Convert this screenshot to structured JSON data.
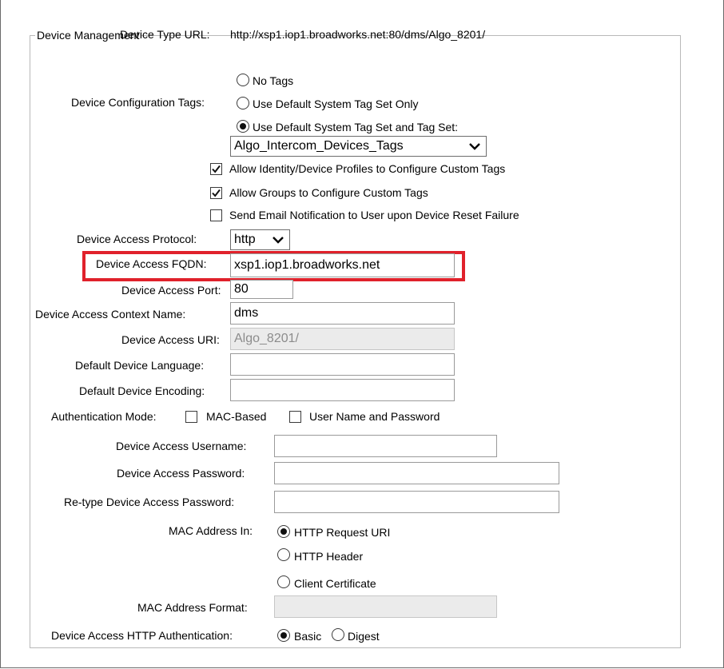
{
  "section": {
    "legend": "Device Management"
  },
  "device_type_url": {
    "label": "Device Type URL:",
    "value": "http://xsp1.iop1.broadworks.net:80/dms/Algo_8201/"
  },
  "config_tags": {
    "label": "Device Configuration Tags:",
    "opt_no_tags": "No Tags",
    "opt_default_only": "Use Default System Tag Set Only",
    "opt_default_and_set": "Use Default System Tag Set and Tag Set:",
    "selected": "opt_default_and_set",
    "tag_set_value": "Algo_Intercom_Devices_Tags"
  },
  "checkboxes": {
    "allow_identity": {
      "label": "Allow Identity/Device Profiles to Configure Custom Tags",
      "checked": true
    },
    "allow_groups": {
      "label": "Allow Groups to Configure Custom Tags",
      "checked": true
    },
    "send_email": {
      "label": "Send Email Notification to User upon Device Reset Failure",
      "checked": false
    }
  },
  "access_protocol": {
    "label": "Device Access Protocol:",
    "value": "http"
  },
  "access_fqdn": {
    "label": "Device Access FQDN:",
    "value": "xsp1.iop1.broadworks.net"
  },
  "access_port": {
    "label": "Device Access Port:",
    "value": "80"
  },
  "context_name": {
    "label": "Device Access Context Name:",
    "value": "dms"
  },
  "access_uri": {
    "label": "Device Access URI:",
    "value": "Algo_8201/"
  },
  "default_language": {
    "label": "Default Device Language:",
    "value": ""
  },
  "default_encoding": {
    "label": "Default Device Encoding:",
    "value": ""
  },
  "auth_mode": {
    "label": "Authentication Mode:",
    "mac_based": {
      "label": "MAC-Based",
      "checked": false
    },
    "user_pass": {
      "label": "User Name and Password",
      "checked": false
    }
  },
  "access_username": {
    "label": "Device Access Username:",
    "value": ""
  },
  "access_password": {
    "label": "Device Access Password:",
    "value": ""
  },
  "retype_password": {
    "label": "Re-type Device Access Password:",
    "value": ""
  },
  "mac_address_in": {
    "label": "MAC Address In:",
    "opt_request_uri": "HTTP Request URI",
    "opt_header": "HTTP Header",
    "opt_client_cert": "Client Certificate",
    "selected": "opt_request_uri"
  },
  "mac_address_format": {
    "label": "MAC Address Format:",
    "value": ""
  },
  "http_auth": {
    "label": "Device Access HTTP Authentication:",
    "opt_basic": "Basic",
    "opt_digest": "Digest",
    "selected": "opt_basic"
  },
  "colors": {
    "highlight": "#e0212b",
    "disabled_bg": "#ebebeb",
    "disabled_text": "#8c8c8c"
  }
}
